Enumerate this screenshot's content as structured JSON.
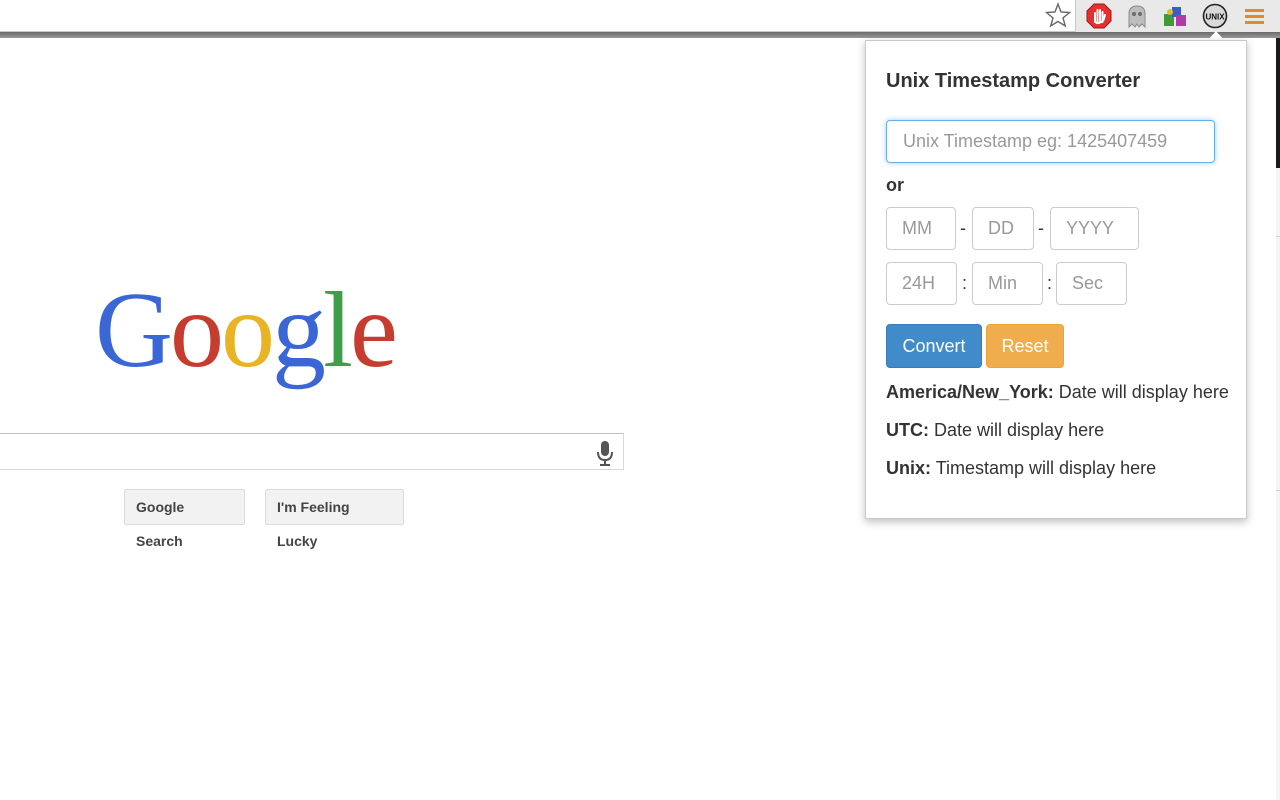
{
  "browser": {
    "icons": [
      "star-icon",
      "adblock-icon",
      "ghostery-icon",
      "puzzle-extension-icon",
      "unix-extension-icon",
      "menu-icon"
    ]
  },
  "google": {
    "logo_text": "Google",
    "search_button": "Google Search",
    "lucky_button": "I'm Feeling Lucky",
    "logo_colors": [
      "#3b67d6",
      "#c63d2f",
      "#e8b324",
      "#3b67d6",
      "#3e9e4a",
      "#c63d2f"
    ]
  },
  "popup": {
    "title": "Unix Timestamp Converter",
    "timestamp_placeholder": "Unix Timestamp eg: 1425407459",
    "or_label": "or",
    "date": {
      "month_placeholder": "MM",
      "day_placeholder": "DD",
      "year_placeholder": "YYYY",
      "separator": "-"
    },
    "time": {
      "hour_placeholder": "24H",
      "minute_placeholder": "Min",
      "second_placeholder": "Sec",
      "separator": ":"
    },
    "convert_button": "Convert",
    "reset_button": "Reset",
    "results": {
      "ny_label": "America/New_York:",
      "ny_value": "Date will display here",
      "utc_label": "UTC:",
      "utc_value": "Date will display here",
      "unix_label": "Unix:",
      "unix_value": "Timestamp will display here"
    },
    "colors": {
      "convert": "#428bca",
      "reset": "#f0ad4e",
      "focus": "#66afe9"
    }
  }
}
